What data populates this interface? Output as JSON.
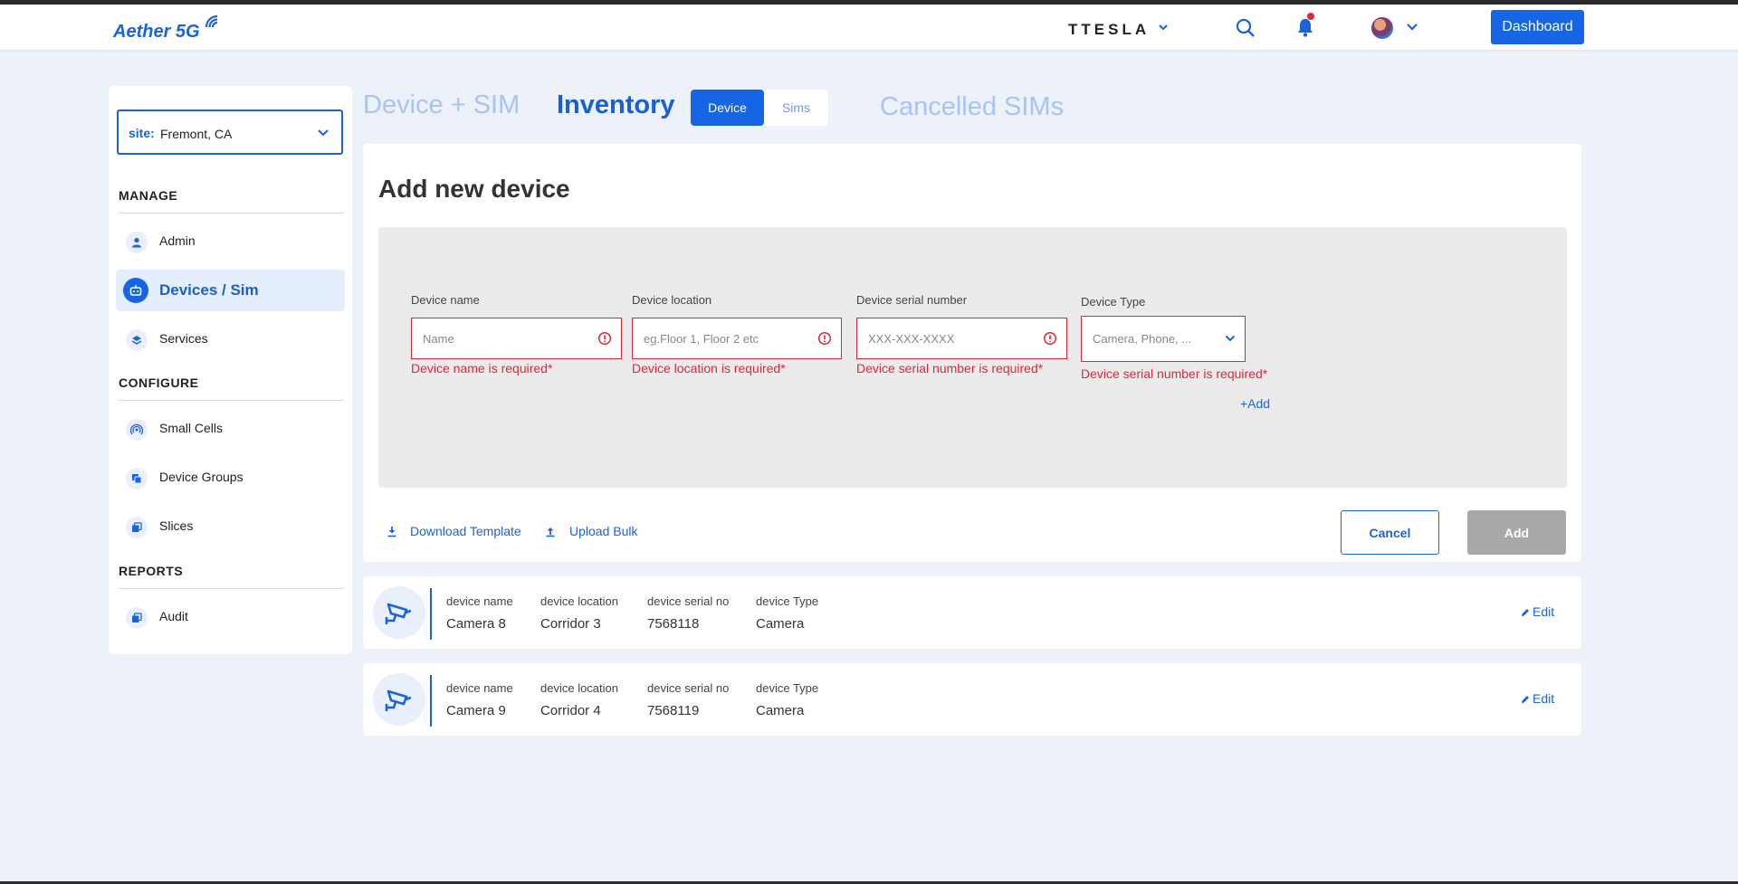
{
  "header": {
    "logo": "Aether 5G",
    "brand": "TTESLA",
    "dashboard_label": "Dashboard"
  },
  "sidebar": {
    "site_label": "site:",
    "site_value": "Fremont, CA",
    "sections": {
      "manage": "MANAGE",
      "configure": "CONFIGURE",
      "reports": "REPORTS"
    },
    "items": [
      {
        "label": "Admin",
        "icon": "person-icon"
      },
      {
        "label": "Devices / Sim",
        "icon": "robot-icon",
        "active": true
      },
      {
        "label": "Services",
        "icon": "layers-icon"
      },
      {
        "label": "Small Cells",
        "icon": "signal-icon"
      },
      {
        "label": "Device Groups",
        "icon": "copy-icon"
      },
      {
        "label": "Slices",
        "icon": "stack-icon"
      },
      {
        "label": "Audit",
        "icon": "stack-icon"
      }
    ]
  },
  "tabs": {
    "device_sim": "Device + SIM",
    "inventory": "Inventory",
    "seg_device": "Device",
    "seg_sims": "Sims",
    "cancelled": "Cancelled SIMs"
  },
  "form": {
    "title": "Add new device",
    "fields": [
      {
        "label": "Device name",
        "placeholder": "Name",
        "error": "Device name is required*"
      },
      {
        "label": "Device location",
        "placeholder": "eg.Floor 1, Floor 2 etc",
        "error": "Device location is required*"
      },
      {
        "label": "Device serial number",
        "placeholder": "XXX-XXX-XXXX",
        "error": "Device serial number is required*"
      },
      {
        "label": "Device Type",
        "placeholder": "Camera, Phone, ...",
        "error": "Device serial number is required*"
      }
    ],
    "add_link": "+Add",
    "download_template": "Download Template",
    "upload_bulk": "Upload Bulk",
    "cancel_label": "Cancel",
    "add_label": "Add"
  },
  "devices": {
    "headers": [
      "device name",
      "device location",
      "device serial no",
      "device Type"
    ],
    "rows": [
      {
        "name": "Camera 8",
        "location": "Corridor 3",
        "serial": "7568118",
        "type": "Camera"
      },
      {
        "name": "Camera 9",
        "location": "Corridor 4",
        "serial": "7568119",
        "type": "Camera"
      }
    ],
    "edit_label": "Edit"
  },
  "colors": {
    "primary": "#1565e5",
    "error": "#e0263a",
    "background": "#edf1fa"
  }
}
